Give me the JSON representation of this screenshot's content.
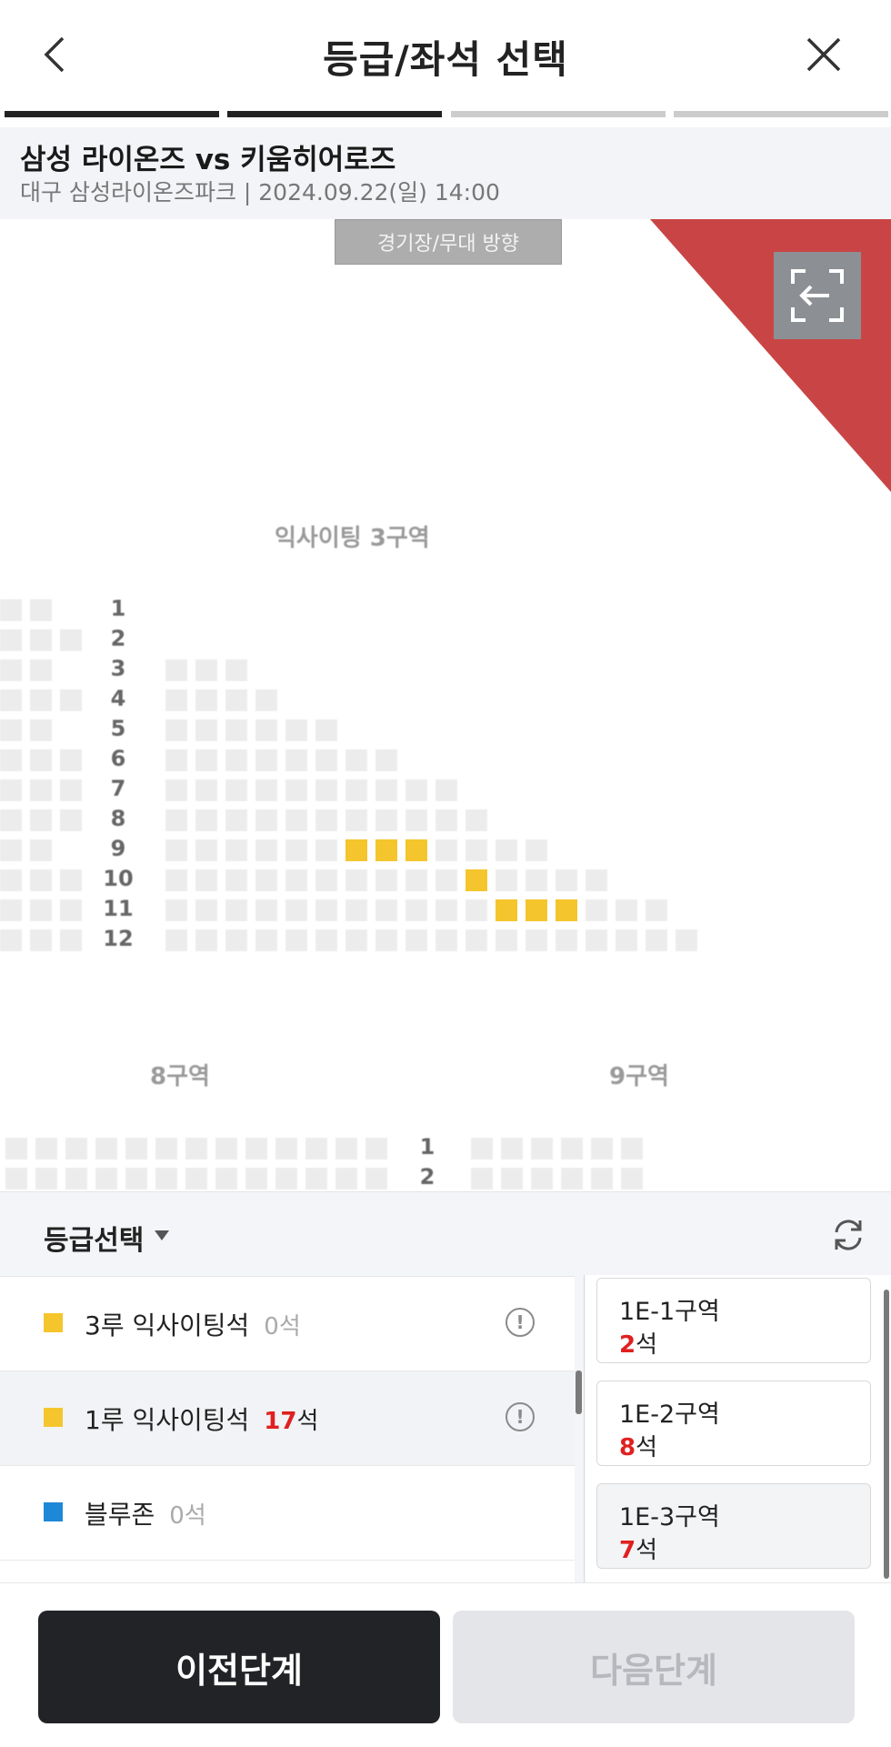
{
  "header": {
    "title": "등급/좌석 선택",
    "steps": [
      {
        "state": "done"
      },
      {
        "state": "done"
      },
      {
        "state": "todo"
      },
      {
        "state": "todo"
      }
    ]
  },
  "game": {
    "title": "삼성 라이온즈 vs 키움히어로즈",
    "venue_date": "대구 삼성라이온즈파크 | 2024.09.22(일) 14:00"
  },
  "seatmap": {
    "stage_label": "경기장/무대 방향",
    "zone_main": "익사이팅 3구역",
    "zone_left": "8구역",
    "zone_right": "9구역",
    "rows": [
      "1",
      "2",
      "3",
      "4",
      "5",
      "6",
      "7",
      "8",
      "9",
      "10",
      "11",
      "12"
    ],
    "lower_rows": [
      "1",
      "2"
    ],
    "available_color": "#f5c52d",
    "corner_color": "#c94545"
  },
  "grade_panel": {
    "label": "등급선택",
    "grades": [
      {
        "name": "3루 익사이팅석",
        "count": "0",
        "unit": "석",
        "color": "#f5c52d",
        "selected": false
      },
      {
        "name": "1루 익사이팅석",
        "count": "17",
        "unit": "석",
        "color": "#f5c52d",
        "selected": true
      },
      {
        "name": "블루존",
        "count": "0",
        "unit": "석",
        "color": "#1e88d8",
        "selected": false
      }
    ],
    "zones": [
      {
        "name": "1E-1구역",
        "count": "2",
        "unit": "석"
      },
      {
        "name": "1E-2구역",
        "count": "8",
        "unit": "석"
      },
      {
        "name": "1E-3구역",
        "count": "7",
        "unit": "석"
      }
    ]
  },
  "buttons": {
    "prev": "이전단계",
    "next": "다음단계"
  }
}
